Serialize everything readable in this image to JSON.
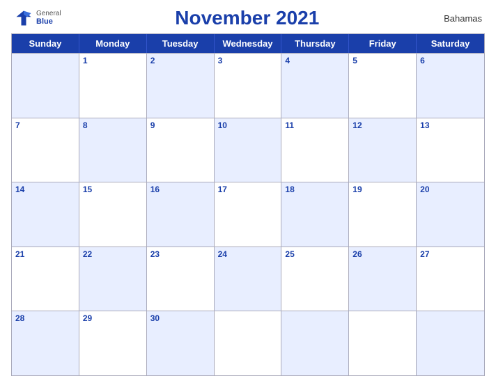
{
  "header": {
    "logo_general": "General",
    "logo_blue": "Blue",
    "title": "November 2021",
    "country": "Bahamas"
  },
  "days_of_week": [
    "Sunday",
    "Monday",
    "Tuesday",
    "Wednesday",
    "Thursday",
    "Friday",
    "Saturday"
  ],
  "weeks": [
    [
      {
        "num": "",
        "empty": true
      },
      {
        "num": "1"
      },
      {
        "num": "2"
      },
      {
        "num": "3"
      },
      {
        "num": "4"
      },
      {
        "num": "5"
      },
      {
        "num": "6"
      }
    ],
    [
      {
        "num": "7"
      },
      {
        "num": "8"
      },
      {
        "num": "9"
      },
      {
        "num": "10"
      },
      {
        "num": "11"
      },
      {
        "num": "12"
      },
      {
        "num": "13"
      }
    ],
    [
      {
        "num": "14"
      },
      {
        "num": "15"
      },
      {
        "num": "16"
      },
      {
        "num": "17"
      },
      {
        "num": "18"
      },
      {
        "num": "19"
      },
      {
        "num": "20"
      }
    ],
    [
      {
        "num": "21"
      },
      {
        "num": "22"
      },
      {
        "num": "23"
      },
      {
        "num": "24"
      },
      {
        "num": "25"
      },
      {
        "num": "26"
      },
      {
        "num": "27"
      }
    ],
    [
      {
        "num": "28"
      },
      {
        "num": "29"
      },
      {
        "num": "30"
      },
      {
        "num": "",
        "empty": true
      },
      {
        "num": "",
        "empty": true
      },
      {
        "num": "",
        "empty": true
      },
      {
        "num": "",
        "empty": true
      }
    ]
  ],
  "colors": {
    "blue": "#1a3faa",
    "light_blue_row": "#dce4f7",
    "white": "#ffffff"
  }
}
